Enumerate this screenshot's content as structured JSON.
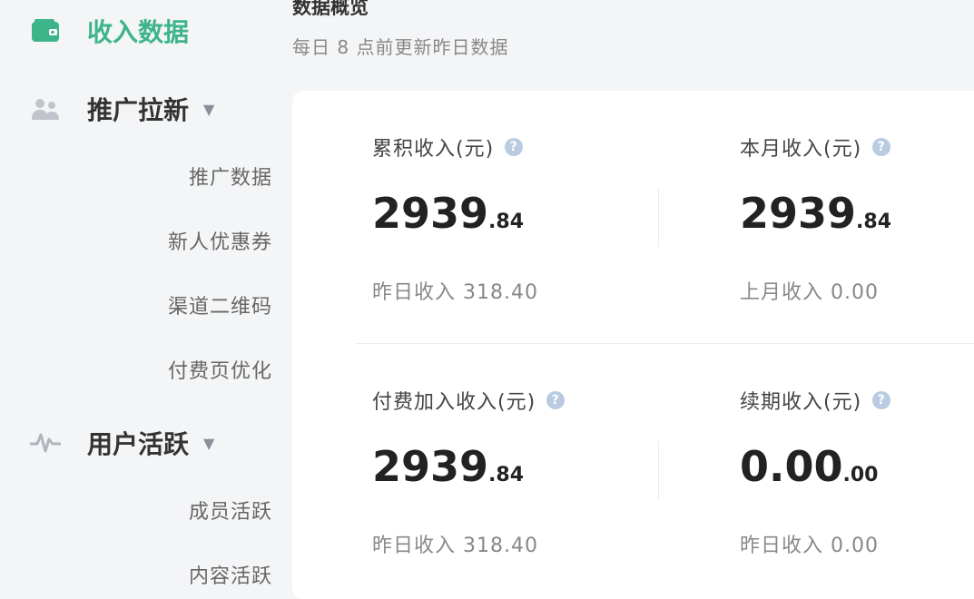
{
  "sidebar": {
    "income": {
      "label": "收入数据",
      "icon": "wallet-icon",
      "active": true
    },
    "promotion": {
      "label": "推广拉新",
      "icon": "users-icon",
      "items": [
        "推广数据",
        "新人优惠券",
        "渠道二维码",
        "付费页优化"
      ]
    },
    "activity": {
      "label": "用户活跃",
      "icon": "pulse-icon",
      "items": [
        "成员活跃",
        "内容活跃"
      ]
    }
  },
  "header": {
    "title": "数据概览",
    "subtitle": "每日 8 点前更新昨日数据"
  },
  "stats": [
    {
      "label": "累积收入(元)",
      "int": "2939",
      "dec": ".84",
      "sub": "昨日收入 318.40"
    },
    {
      "label": "本月收入(元)",
      "int": "2939",
      "dec": ".84",
      "sub": "上月收入 0.00"
    },
    {
      "label": "付费加入收入(元)",
      "int": "2939",
      "dec": ".84",
      "sub": "昨日收入 318.40"
    },
    {
      "label": "续期收入(元)",
      "int": "0.00",
      "dec": ".00",
      "sub": "昨日收入 0.00"
    }
  ],
  "colors": {
    "accent": "#3eb48b",
    "help": "#b8cbe0"
  }
}
